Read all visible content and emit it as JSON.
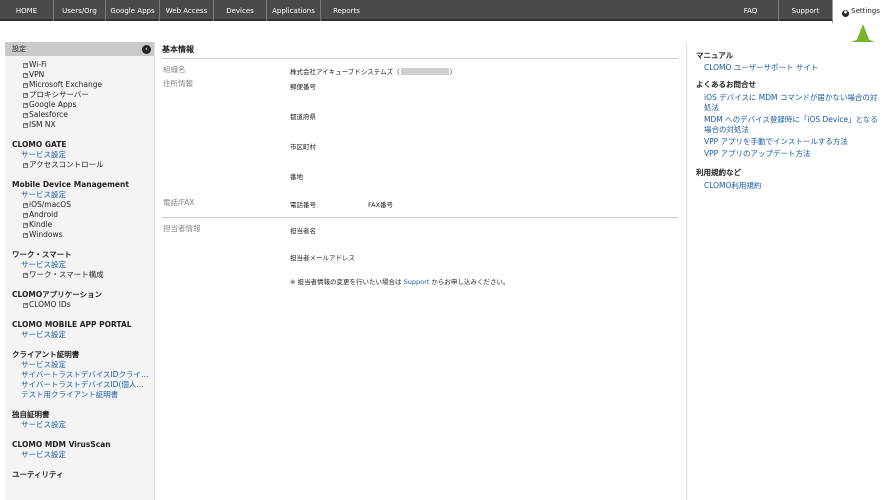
{
  "topnav": {
    "items": [
      "HOME",
      "Users/Org",
      "Google Apps",
      "Web Access",
      "Devices",
      "Applications",
      "Reports"
    ],
    "faq": "FAQ",
    "support": "Support",
    "settings": "Settings"
  },
  "badge": "1",
  "sidebar": {
    "header": "設定",
    "top_items": [
      "Wi-Fi",
      "VPN",
      "Microsoft Exchange",
      "プロキシサーバー",
      "Google Apps",
      "Salesforce",
      "ISM NX"
    ],
    "gate": {
      "title": "CLOMO GATE",
      "link": "サービス設定",
      "sub": "アクセスコントロール"
    },
    "mdm": {
      "title": "Mobile Device Management",
      "link": "サービス設定",
      "subs": [
        "iOS/macOS",
        "Android",
        "Kindle",
        "Windows"
      ]
    },
    "work": {
      "title": "ワーク・スマート",
      "link": "サービス設定",
      "sub": "ワーク・スマート構成"
    },
    "apps": {
      "title": "CLOMOアプリケーション",
      "sub": "CLOMO IDs"
    },
    "portal": {
      "title": "CLOMO MOBILE APP PORTAL",
      "link": "サービス設定"
    },
    "client_cert": {
      "title": "クライアント証明書",
      "links": [
        "サービス設定",
        "サイバートラストデバイスIDクライ…",
        "サイバートラストデバイスID(個人…",
        "テスト用クライアント証明書"
      ]
    },
    "own_cert": {
      "title": "独自証明書",
      "link": "サービス設定"
    },
    "virus": {
      "title": "CLOMO MDM VirusScan",
      "link": "サービス設定"
    },
    "utility": {
      "title": "ユーティリティ"
    }
  },
  "main": {
    "title": "基本情報",
    "org_label": "組織名",
    "org_value_prefix": "株式会社アイキューブドシステムズ（",
    "org_value_suffix": "）",
    "address_label": "住所情報",
    "postal": "郵便番号",
    "prefecture": "都道府県",
    "city": "市区町村",
    "street": "番地",
    "phone_label": "電話/FAX",
    "phone": "電話番号",
    "fax": "FAX番号",
    "contact_label": "担当者情報",
    "contact_name": "担当者名",
    "contact_email": "担当者メールアドレス",
    "note_prefix": "※ 担当者情報の変更を行いたい場合は",
    "note_link": "Support",
    "note_suffix": "からお申し込みください。"
  },
  "right": {
    "manual_title": "マニュアル",
    "manual_link": "CLOMO ユーザーサポート サイト",
    "faq_title": "よくあるお問合せ",
    "faq_links": [
      "iOS デバイスに MDM コマンドが届かない場合の対処法",
      "MDM へのデバイス登録時に「iOS Device」となる場合の対処法",
      "VPP アプリを手動でインストールする方法",
      "VPP アプリのアップデート方法"
    ],
    "terms_title": "利用規約など",
    "terms_link": "CLOMO利用規約"
  }
}
